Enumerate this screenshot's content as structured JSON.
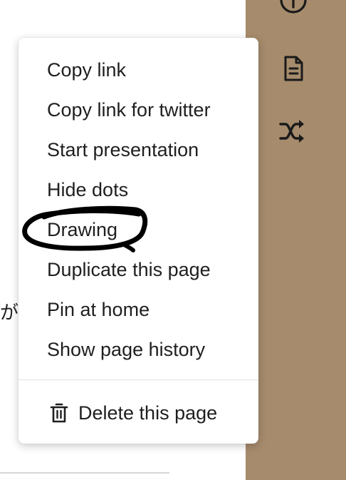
{
  "background_text": "が",
  "sidebar": {
    "color": "#a68b6c",
    "icons": [
      "info-icon",
      "page-icon",
      "shuffle-icon"
    ]
  },
  "menu": {
    "items": [
      {
        "label": "Copy link"
      },
      {
        "label": "Copy link for twitter"
      },
      {
        "label": "Start presentation"
      },
      {
        "label": "Hide dots"
      },
      {
        "label": "Drawing"
      },
      {
        "label": "Duplicate this page"
      },
      {
        "label": "Pin at home"
      },
      {
        "label": "Show page history"
      }
    ],
    "delete": {
      "label": "Delete this page",
      "icon": "trash-icon"
    }
  },
  "annotation": {
    "color": "#000000"
  }
}
